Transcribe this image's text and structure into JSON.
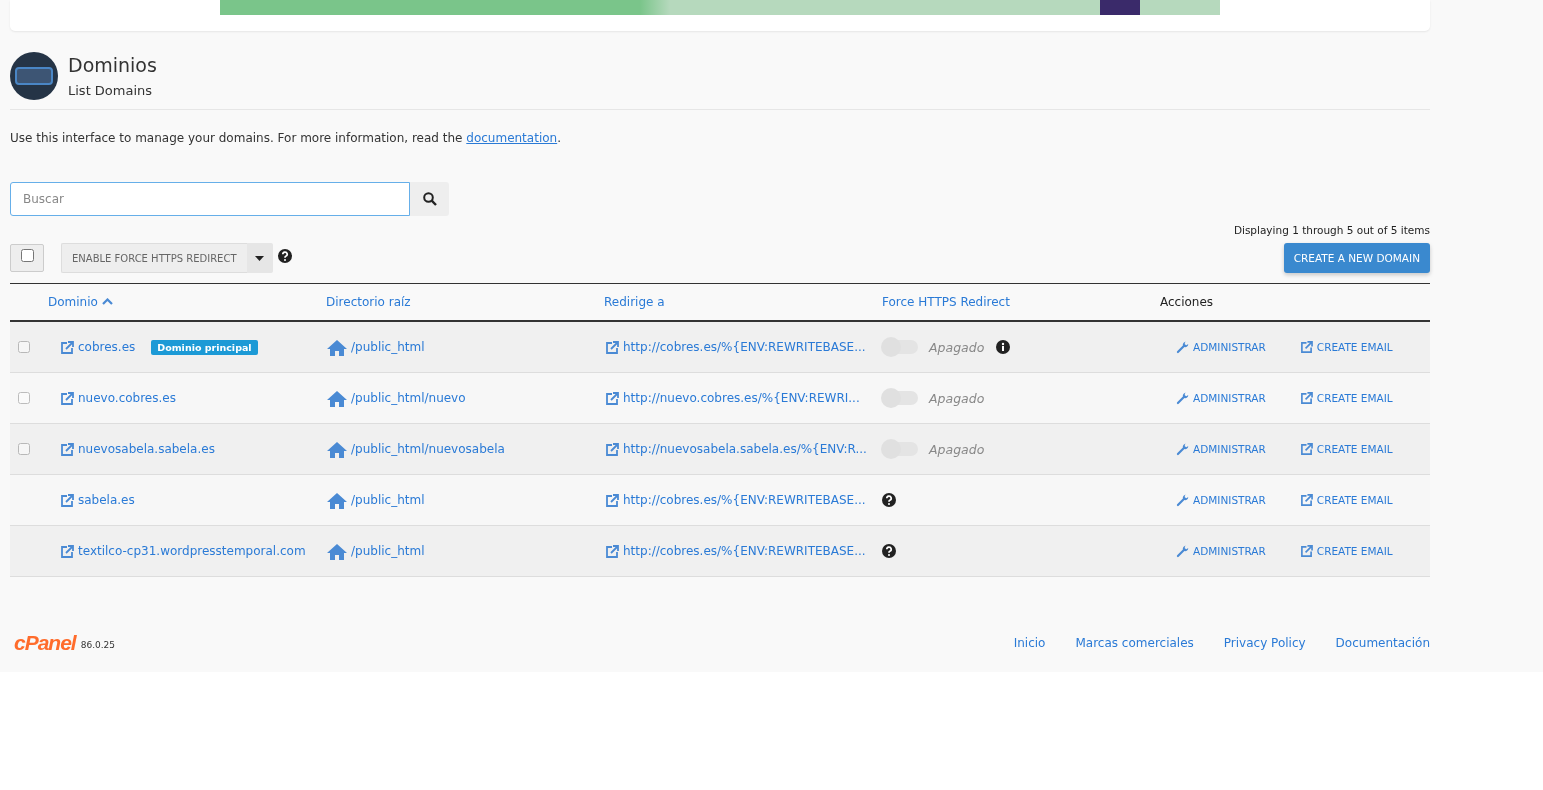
{
  "page_header": {
    "title": "Dominios",
    "subtitle": "List Domains"
  },
  "intro": {
    "text": "Use this interface to manage your domains. For more information, read the ",
    "link": "documentation",
    "after": "."
  },
  "search": {
    "placeholder": "Buscar"
  },
  "paging": "Displaying 1 through 5 out of 5 items",
  "toolbar": {
    "select_all": {
      "checked": false
    },
    "bulk_action": "ENABLE FORCE HTTPS REDIRECT",
    "create_button": "CREATE A NEW DOMAIN"
  },
  "table": {
    "columns": [
      {
        "label": "Dominio",
        "kind": "sortable",
        "sorted": true
      },
      {
        "label": "Directorio raíz",
        "kind": "sortable",
        "sorted": false
      },
      {
        "label": "Redirige a",
        "kind": "sortable",
        "sorted": false
      },
      {
        "label": "Force HTTPS Redirect",
        "kind": "sortable",
        "sorted": false
      },
      {
        "label": "Acciones",
        "kind": "plain"
      }
    ],
    "rows": [
      {
        "kind": "editable",
        "checked": false,
        "domain": "cobres.es",
        "badge": "Dominio principal",
        "root": "/public_html",
        "redirect": "http://cobres.es/%{ENV:REWRITEBASE...",
        "https": {
          "kind": "toggle",
          "on": false,
          "status": "Apagado",
          "info": true
        },
        "actions": [
          "ADMINISTRAR",
          "CREATE EMAIL"
        ]
      },
      {
        "kind": "editable",
        "checked": false,
        "domain": "nuevo.cobres.es",
        "root": "/public_html/nuevo",
        "redirect": "http://nuevo.cobres.es/%{ENV:REWRI...",
        "https": {
          "kind": "toggle",
          "on": false,
          "status": "Apagado",
          "info": false
        },
        "actions": [
          "ADMINISTRAR",
          "CREATE EMAIL"
        ]
      },
      {
        "kind": "editable",
        "checked": false,
        "domain": "nuevosabela.sabela.es",
        "root": "/public_html/nuevosabela",
        "redirect": "http://nuevosabela.sabela.es/%{ENV:R...",
        "https": {
          "kind": "toggle",
          "on": false,
          "status": "Apagado",
          "info": false
        },
        "actions": [
          "ADMINISTRAR",
          "CREATE EMAIL"
        ]
      },
      {
        "kind": "fixed",
        "domain": "sabela.es",
        "root": "/public_html",
        "redirect": "http://cobres.es/%{ENV:REWRITEBASE...",
        "https": {
          "kind": "help"
        },
        "actions": [
          "ADMINISTRAR",
          "CREATE EMAIL"
        ]
      },
      {
        "kind": "fixed",
        "domain": "textilco-cp31.wordpresstemporal.com",
        "root": "/public_html",
        "redirect": "http://cobres.es/%{ENV:REWRITEBASE...",
        "https": {
          "kind": "help"
        },
        "actions": [
          "ADMINISTRAR",
          "CREATE EMAIL"
        ]
      }
    ]
  },
  "footer": {
    "logo": "cPanel",
    "version": "86.0.25",
    "links": [
      "Inicio",
      "Marcas comerciales",
      "Privacy Policy",
      "Documentación"
    ]
  }
}
